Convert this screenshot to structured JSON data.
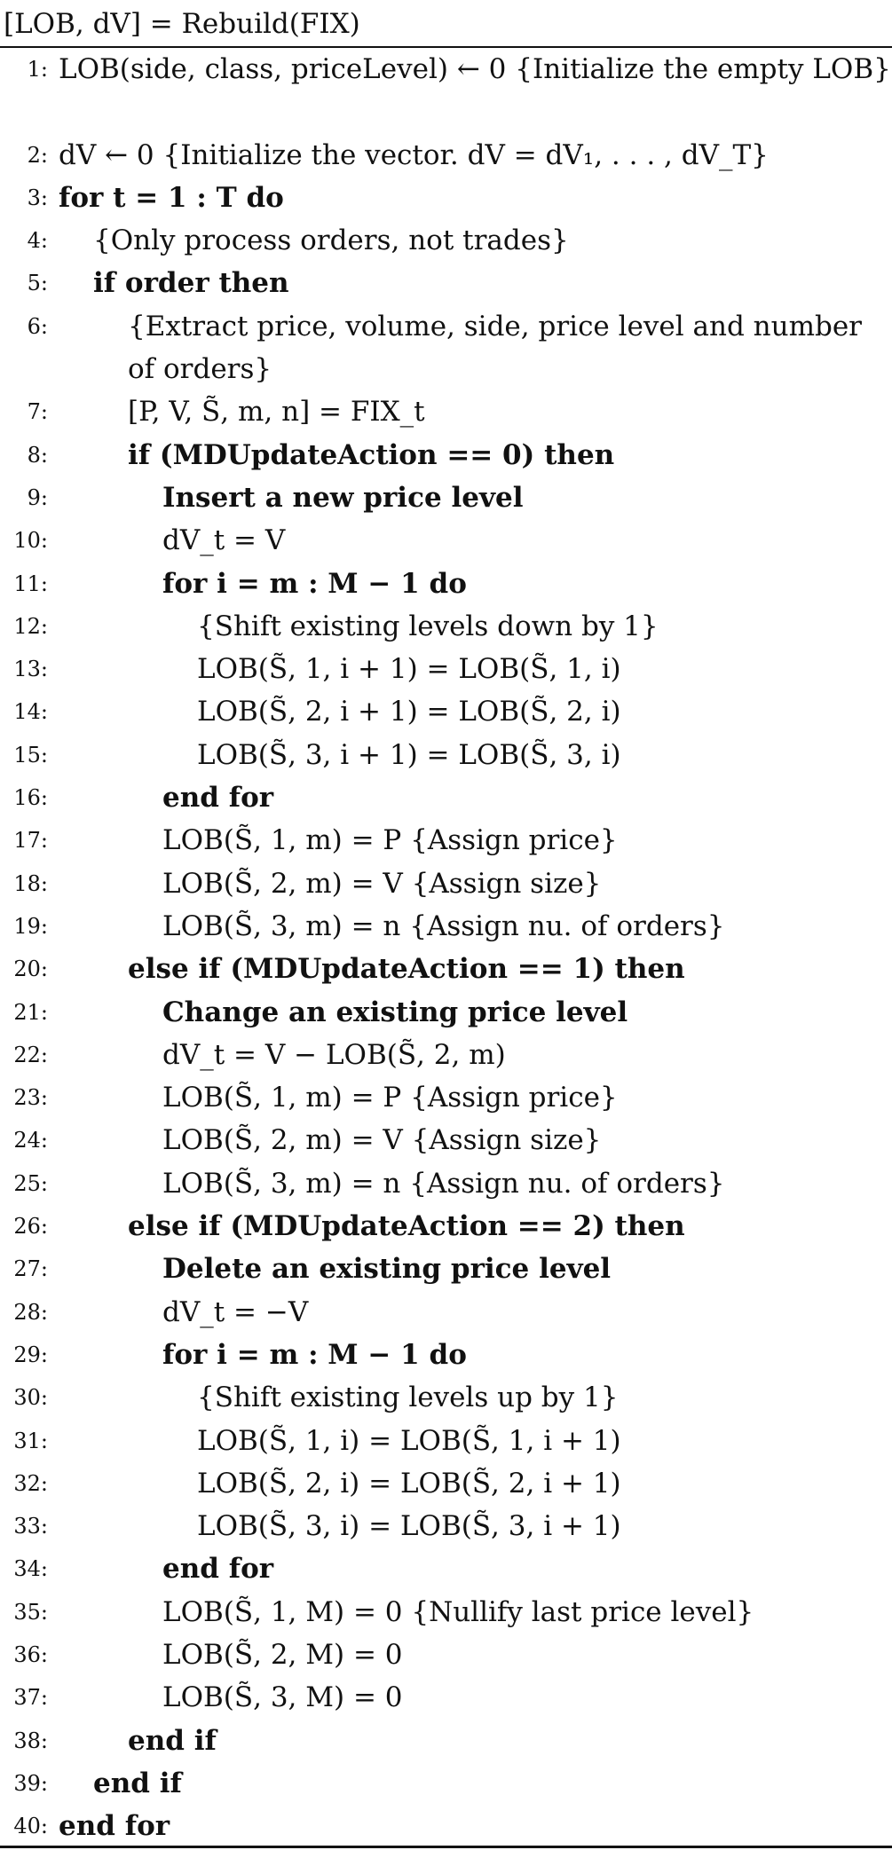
{
  "header": "[LOB, dV] = Rebuild(FIX)",
  "lines": [
    {
      "n": "1:",
      "indent": 0,
      "kw": false,
      "text": "LOB(side, class, priceLevel) ← 0 {Initialize the empty LOB}",
      "wrap": true
    },
    {
      "n": "2:",
      "indent": 0,
      "kw": false,
      "text": "dV ← 0 {Initialize the vector. dV = dV₁, . . . , dV_T}"
    },
    {
      "n": "3:",
      "indent": 0,
      "kw": true,
      "text": "for t = 1 : T do"
    },
    {
      "n": "4:",
      "indent": 1,
      "kw": false,
      "text": "{Only process orders, not trades}"
    },
    {
      "n": "5:",
      "indent": 1,
      "kw": true,
      "text": "if order then"
    },
    {
      "n": "6:",
      "indent": 2,
      "kw": false,
      "text": "{Extract price, volume, side, price level and number of orders}",
      "wrap": true
    },
    {
      "n": "7:",
      "indent": 2,
      "kw": false,
      "text": "[P, V, S̃, m, n] = FIX_t"
    },
    {
      "n": "8:",
      "indent": 2,
      "kw": true,
      "text": "if (MDUpdateAction == 0) then"
    },
    {
      "n": "9:",
      "indent": 3,
      "kw": true,
      "text": "Insert a new price level"
    },
    {
      "n": "10:",
      "indent": 3,
      "kw": false,
      "text": "dV_t = V"
    },
    {
      "n": "11:",
      "indent": 3,
      "kw": true,
      "text": "for i = m : M − 1 do"
    },
    {
      "n": "12:",
      "indent": 4,
      "kw": false,
      "text": "{Shift existing levels down by 1}"
    },
    {
      "n": "13:",
      "indent": 4,
      "kw": false,
      "text": "LOB(S̃, 1, i + 1) = LOB(S̃, 1, i)"
    },
    {
      "n": "14:",
      "indent": 4,
      "kw": false,
      "text": "LOB(S̃, 2, i + 1) = LOB(S̃, 2, i)"
    },
    {
      "n": "15:",
      "indent": 4,
      "kw": false,
      "text": "LOB(S̃, 3, i + 1) = LOB(S̃, 3, i)"
    },
    {
      "n": "16:",
      "indent": 3,
      "kw": true,
      "text": "end for"
    },
    {
      "n": "17:",
      "indent": 3,
      "kw": false,
      "text": "LOB(S̃, 1, m) = P      {Assign price}"
    },
    {
      "n": "18:",
      "indent": 3,
      "kw": false,
      "text": "LOB(S̃, 2, m) = V      {Assign size}"
    },
    {
      "n": "19:",
      "indent": 3,
      "kw": false,
      "text": "LOB(S̃, 3, m) = n  {Assign nu. of orders}"
    },
    {
      "n": "20:",
      "indent": 2,
      "kw": true,
      "text": "else if (MDUpdateAction == 1) then"
    },
    {
      "n": "21:",
      "indent": 3,
      "kw": true,
      "text": "Change an existing price level"
    },
    {
      "n": "22:",
      "indent": 3,
      "kw": false,
      "text": "dV_t = V − LOB(S̃, 2, m)"
    },
    {
      "n": "23:",
      "indent": 3,
      "kw": false,
      "text": "LOB(S̃, 1, m) = P      {Assign price}"
    },
    {
      "n": "24:",
      "indent": 3,
      "kw": false,
      "text": "LOB(S̃, 2, m) = V      {Assign size}"
    },
    {
      "n": "25:",
      "indent": 3,
      "kw": false,
      "text": "LOB(S̃, 3, m) = n  {Assign nu. of orders}"
    },
    {
      "n": "26:",
      "indent": 2,
      "kw": true,
      "text": "else if (MDUpdateAction == 2) then"
    },
    {
      "n": "27:",
      "indent": 3,
      "kw": true,
      "text": "Delete an existing price level"
    },
    {
      "n": "28:",
      "indent": 3,
      "kw": false,
      "text": "dV_t = −V"
    },
    {
      "n": "29:",
      "indent": 3,
      "kw": true,
      "text": "for i = m : M − 1 do"
    },
    {
      "n": "30:",
      "indent": 4,
      "kw": false,
      "text": "{Shift existing levels up by 1}"
    },
    {
      "n": "31:",
      "indent": 4,
      "kw": false,
      "text": "LOB(S̃, 1, i) = LOB(S̃, 1, i + 1)"
    },
    {
      "n": "32:",
      "indent": 4,
      "kw": false,
      "text": "LOB(S̃, 2, i) = LOB(S̃, 2, i + 1)"
    },
    {
      "n": "33:",
      "indent": 4,
      "kw": false,
      "text": "LOB(S̃, 3, i) = LOB(S̃, 3, i + 1)"
    },
    {
      "n": "34:",
      "indent": 3,
      "kw": true,
      "text": "end for"
    },
    {
      "n": "35:",
      "indent": 3,
      "kw": false,
      "text": "LOB(S̃, 1, M) = 0 {Nullify last price level}"
    },
    {
      "n": "36:",
      "indent": 3,
      "kw": false,
      "text": "LOB(S̃, 2, M) = 0"
    },
    {
      "n": "37:",
      "indent": 3,
      "kw": false,
      "text": "LOB(S̃, 3, M) = 0"
    },
    {
      "n": "38:",
      "indent": 2,
      "kw": true,
      "text": "end if"
    },
    {
      "n": "39:",
      "indent": 1,
      "kw": true,
      "text": "end if"
    },
    {
      "n": "40:",
      "indent": 0,
      "kw": true,
      "text": "end for"
    }
  ]
}
